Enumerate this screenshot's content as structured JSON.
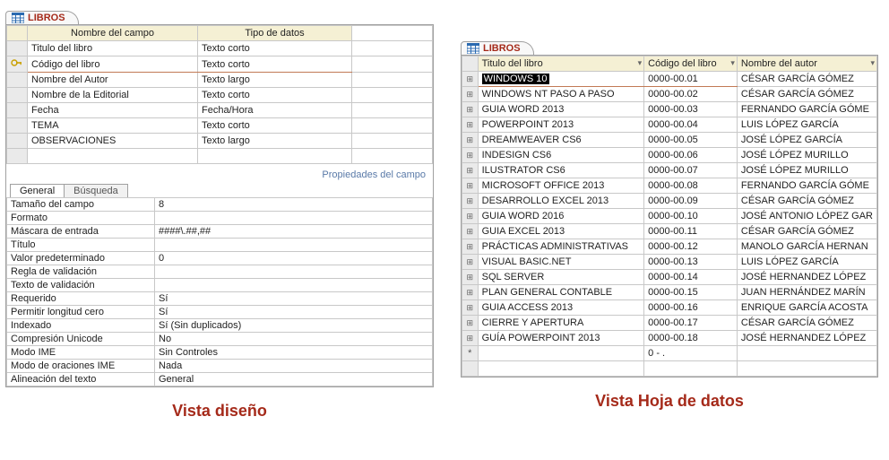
{
  "left": {
    "tab_label": "LIBROS",
    "headers": {
      "name": "Nombre del campo",
      "type": "Tipo de datos"
    },
    "fields": [
      {
        "name": "Titulo del libro",
        "type": "Texto corto",
        "pk": false
      },
      {
        "name": "Código del libro",
        "type": "Texto corto",
        "pk": true
      },
      {
        "name": "Nombre del Autor",
        "type": "Texto largo",
        "pk": false
      },
      {
        "name": "Nombre de la Editorial",
        "type": "Texto corto",
        "pk": false
      },
      {
        "name": "Fecha",
        "type": "Fecha/Hora",
        "pk": false
      },
      {
        "name": "TEMA",
        "type": "Texto corto",
        "pk": false
      },
      {
        "name": "OBSERVACIONES",
        "type": "Texto largo",
        "pk": false
      }
    ],
    "props_caption": "Propiedades del campo",
    "props_tabs": {
      "general": "General",
      "search": "Búsqueda"
    },
    "props": [
      {
        "k": "Tamaño del campo",
        "v": "8"
      },
      {
        "k": "Formato",
        "v": ""
      },
      {
        "k": "Máscara de entrada",
        "v": "####\\.##,##"
      },
      {
        "k": "Título",
        "v": ""
      },
      {
        "k": "Valor predeterminado",
        "v": "0"
      },
      {
        "k": "Regla de validación",
        "v": ""
      },
      {
        "k": "Texto de validación",
        "v": ""
      },
      {
        "k": "Requerido",
        "v": "Sí"
      },
      {
        "k": "Permitir longitud cero",
        "v": "Sí"
      },
      {
        "k": "Indexado",
        "v": "Sí (Sin duplicados)"
      },
      {
        "k": "Compresión Unicode",
        "v": "No"
      },
      {
        "k": "Modo IME",
        "v": "Sin Controles"
      },
      {
        "k": "Modo de oraciones IME",
        "v": "Nada"
      },
      {
        "k": "Alineación del texto",
        "v": "General"
      }
    ],
    "caption": "Vista diseño"
  },
  "right": {
    "tab_label": "LIBROS",
    "headers": {
      "c1": "Titulo del libro",
      "c2": "Código del libro",
      "c3": "Nombre del autor"
    },
    "rows": [
      {
        "titulo": "WINDOWS 10",
        "codigo": "0000-00.01",
        "autor": "CÉSAR GARCÍA GÓMEZ"
      },
      {
        "titulo": "WINDOWS NT PASO A PASO",
        "codigo": "0000-00.02",
        "autor": "CÉSAR GARCÍA GÓMEZ"
      },
      {
        "titulo": "GUIA WORD 2013",
        "codigo": "0000-00.03",
        "autor": "FERNANDO GARCÍA GÓME"
      },
      {
        "titulo": "POWERPOINT 2013",
        "codigo": "0000-00.04",
        "autor": "LUIS LÓPEZ GARCÍA"
      },
      {
        "titulo": "DREAMWEAVER CS6",
        "codigo": "0000-00.05",
        "autor": "JOSÉ LÓPEZ GARCÍA"
      },
      {
        "titulo": "INDESIGN CS6",
        "codigo": "0000-00.06",
        "autor": "JOSÉ LÓPEZ MURILLO"
      },
      {
        "titulo": "ILUSTRATOR CS6",
        "codigo": "0000-00.07",
        "autor": "JOSÉ LÓPEZ MURILLO"
      },
      {
        "titulo": "MICROSOFT OFFICE 2013",
        "codigo": "0000-00.08",
        "autor": "FERNANDO GARCÍA GÓME"
      },
      {
        "titulo": "DESARROLLO EXCEL 2013",
        "codigo": "0000-00.09",
        "autor": "CÉSAR GARCÍA GÓMEZ"
      },
      {
        "titulo": "GUIA WORD 2016",
        "codigo": "0000-00.10",
        "autor": "JOSÉ ANTONIO LÓPEZ GAR"
      },
      {
        "titulo": "GUIA EXCEL 2013",
        "codigo": "0000-00.11",
        "autor": "CÉSAR GARCÍA GÓMEZ"
      },
      {
        "titulo": "PRÁCTICAS ADMINISTRATIVAS",
        "codigo": "0000-00.12",
        "autor": "MANOLO GARCÍA HERNAN"
      },
      {
        "titulo": "VISUAL BASIC.NET",
        "codigo": "0000-00.13",
        "autor": "LUIS LÓPEZ GARCÍA"
      },
      {
        "titulo": "SQL SERVER",
        "codigo": "0000-00.14",
        "autor": "JOSÉ HERNANDEZ LÓPEZ"
      },
      {
        "titulo": "PLAN GENERAL CONTABLE",
        "codigo": "0000-00.15",
        "autor": "JUAN HERNÁNDEZ MARÍN"
      },
      {
        "titulo": "GUIA ACCESS 2013",
        "codigo": "0000-00.16",
        "autor": "ENRIQUE GARCÍA ACOSTA"
      },
      {
        "titulo": "CIERRE Y APERTURA",
        "codigo": "0000-00.17",
        "autor": "CÉSAR GARCÍA GÓMEZ"
      },
      {
        "titulo": "GUÍA POWERPOINT 2013",
        "codigo": "0000-00.18",
        "autor": "JOSÉ HERNANDEZ LÓPEZ"
      }
    ],
    "new_row_codigo": "0   -     .",
    "caption": "Vista Hoja de datos"
  }
}
